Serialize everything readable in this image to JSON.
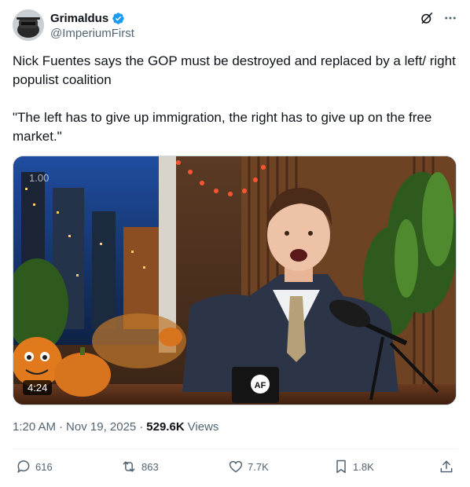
{
  "author": {
    "display_name": "Grimaldus",
    "handle": "@ImperiumFirst",
    "verified": true,
    "verified_color": "#1d9bf0"
  },
  "header_icons": [
    "grok-icon",
    "more-icon"
  ],
  "tweet": {
    "paragraph_1": "Nick Fuentes says the GOP must be destroyed and replaced by a left/ right populist coalition",
    "paragraph_2": "\"The left has to give up immigration, the right has to give up on the free market.\""
  },
  "media": {
    "speed_label": "1.00",
    "duration": "4:24",
    "mug_logo": "AF"
  },
  "meta": {
    "time": "1:20 AM",
    "separator": "·",
    "date": "Nov 19, 2025",
    "views_count": "529.6K",
    "views_label": "Views"
  },
  "actions": {
    "replies": "616",
    "reposts": "863",
    "likes": "7.7K",
    "bookmarks": "1.8K"
  },
  "colors": {
    "text": "#0f1419",
    "secondary": "#536471",
    "accent": "#1d9bf0",
    "divider": "#eff3f4"
  }
}
